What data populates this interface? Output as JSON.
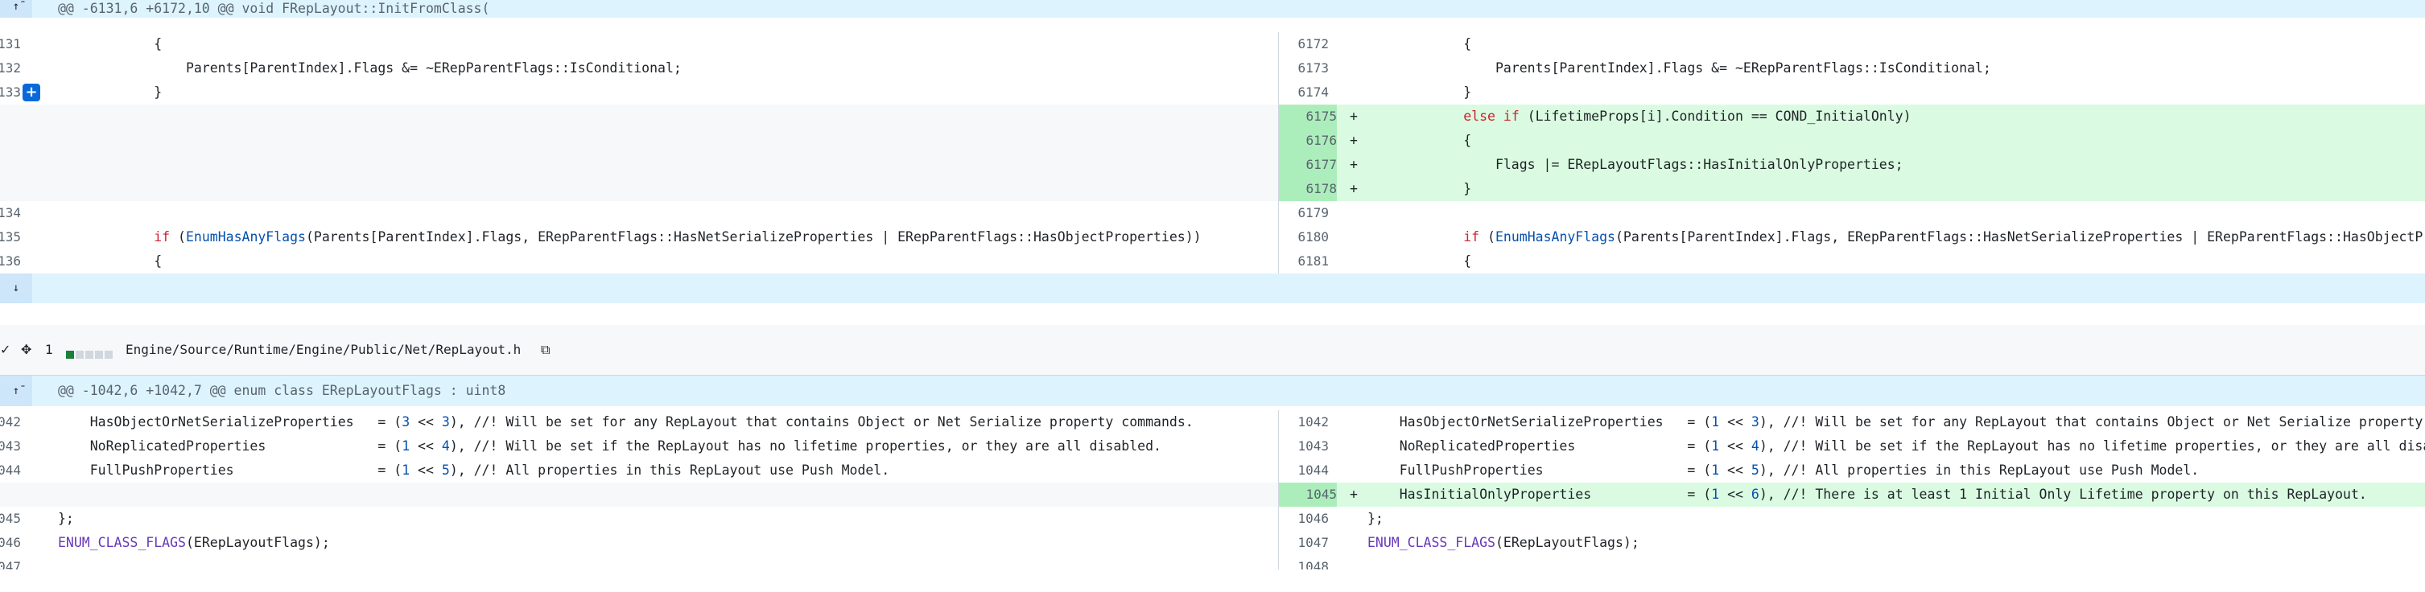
{
  "hunk1": {
    "expand_icon": "expand-up-icon",
    "header": "@@ -6131,6 +6172,10 @@ void FRepLayout::InitFromClass("
  },
  "rows1": [
    {
      "l_num": "131",
      "r_num": "6172",
      "code": "            {"
    },
    {
      "l_num": "132",
      "r_num": "6173",
      "code": "                Parents[ParentIndex].Flags &= ~ERepParentFlags::IsConditional;"
    },
    {
      "l_num": "133",
      "r_num": "6174",
      "code": "            }"
    },
    {
      "r_num": "6175",
      "code_r_kw": "else if",
      "code_r_rest": " (LifetimeProps[i].Condition == COND_InitialOnly)"
    },
    {
      "r_num": "6176",
      "code_r": "            {"
    },
    {
      "r_num": "6177",
      "code_r": "                Flags |= ERepLayoutFlags::HasInitialOnlyProperties;"
    },
    {
      "r_num": "6178",
      "code_r": "            }"
    },
    {
      "l_num": "134",
      "r_num": "6179",
      "code": ""
    },
    {
      "l_num": "135",
      "r_num": "6180"
    },
    {
      "l_num": "136",
      "r_num": "6181",
      "code": "            {"
    }
  ],
  "line135": {
    "kw": "if",
    "fn": "EnumHasAnyFlags",
    "rest_l": "(Parents[ParentIndex].Flags, ERepParentFlags::HasNetSerializeProperties | ERepParentFlags::HasObjectProperties))",
    "rest_r": "(Parents[ParentIndex].Flags, ERepParentFlags::HasNetSerializeProperties | ERepParentFlags::HasObjectPr"
  },
  "add_marker": "+",
  "expand_btn": "+",
  "hunk1_bottom": {
    "expand_icon": "expand-down-icon"
  },
  "file": {
    "collapse_icon": "chevron-check-icon",
    "move_icon": "move-icon",
    "change_count": "1",
    "path": "Engine/Source/Runtime/Engine/Public/Net/RepLayout.h",
    "copy_icon": "copy-icon",
    "diffstat": {
      "added": 1,
      "total": 5
    }
  },
  "hunk2": {
    "expand_icon": "expand-up-icon",
    "header": "@@ -1042,6 +1042,7 @@ enum class ERepLayoutFlags : uint8"
  },
  "rows2": [
    {
      "l_num": "042",
      "r_num": "1042",
      "name": "HasObjectOrNetSerializeProperties",
      "pad": "   ",
      "num": "3",
      "comment_l": "//! Will be set for any RepLayout that contains Object or Net Serialize property commands.",
      "comment_r": "//! Will be set for any RepLayout that contains Object or Net Serialize property"
    },
    {
      "l_num": "043",
      "r_num": "1043",
      "name": "NoReplicatedProperties",
      "pad": "              ",
      "num": "4",
      "comment_l": "//! Will be set if the RepLayout has no lifetime properties, or they are all disabled.",
      "comment_r": "//! Will be set if the RepLayout has no lifetime properties, or they are all disa"
    },
    {
      "l_num": "044",
      "r_num": "1044",
      "name": "FullPushProperties",
      "pad": "                  ",
      "num": "5",
      "comment_l": "//! All properties in this RepLayout use Push Model.",
      "comment_r": "//! All properties in this RepLayout use Push Model."
    },
    {
      "r_num": "1045",
      "name": "HasInitialOnlyProperties",
      "pad": "            ",
      "num": "6",
      "comment_r": "//! There is at least 1 Initial Only Lifetime property on this RepLayout."
    },
    {
      "l_num": "045",
      "r_num": "1046",
      "code": "};"
    },
    {
      "l_num": "046",
      "r_num": "1047",
      "fn": "ENUM_CLASS_FLAGS",
      "rest": "(ERepLayoutFlags);"
    },
    {
      "l_num": "047",
      "r_num": "1048"
    }
  ],
  "colors": {
    "hunk_bg": "#ddf4ff",
    "add_bg": "#dafbe1",
    "add_num_bg": "#aceebb",
    "empty_bg": "#f6f8fa",
    "keyword": "#cf222e",
    "function": "#6639ba",
    "number": "#0550ae",
    "button": "#0969da"
  }
}
